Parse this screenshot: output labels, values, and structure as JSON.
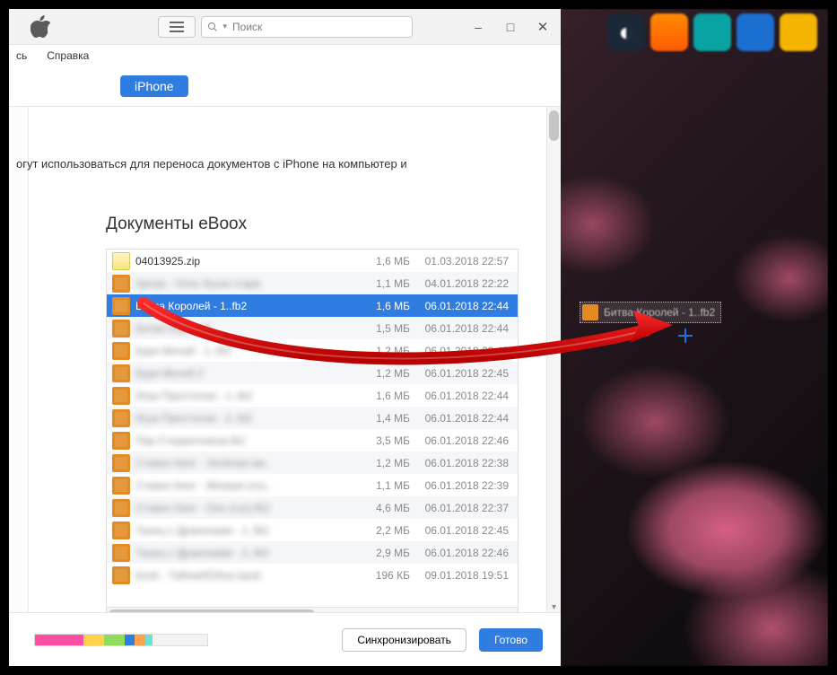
{
  "window": {
    "minimize": "–",
    "maximize": "□",
    "close": "✕"
  },
  "toolbar": {
    "search_icon": "search-icon",
    "search_placeholder": "Поиск",
    "search_chevron": "▾"
  },
  "menubar": {
    "item1": "сь",
    "item2": "Справка"
  },
  "iphone_label": "iPhone",
  "description": "огут использоваться для переноса документов с iPhone на компьютер и",
  "panel_title": "Документы eBoox",
  "files": [
    {
      "icon": "zip",
      "name": "04013925.zip",
      "blur": false,
      "size": "1,6 МБ",
      "date": "01.03.2018 22:57"
    },
    {
      "icon": "fb2",
      "name": "Арчер - Ночь была стара",
      "blur": true,
      "size": "1,1 МБ",
      "date": "04.01.2018 22:22"
    },
    {
      "icon": "fb2",
      "name": "Битва Королей - 1..fb2",
      "blur": false,
      "size": "1,6 МБ",
      "date": "06.01.2018 22:44",
      "selected": true
    },
    {
      "icon": "fb2",
      "name": "Битва Королей",
      "blur": true,
      "size": "1,5 МБ",
      "date": "06.01.2018 22:44"
    },
    {
      "icon": "fb2",
      "name": "Буря Мечей - 1..fb2",
      "blur": true,
      "size": "1,2 МБ",
      "date": "06.01.2018 22:45"
    },
    {
      "icon": "fb2",
      "name": "Буря Мечей 2",
      "blur": true,
      "size": "1,2 МБ",
      "date": "06.01.2018 22:45"
    },
    {
      "icon": "fb2",
      "name": "Игра Престолов - 1..fb2",
      "blur": true,
      "size": "1,6 МБ",
      "date": "06.01.2018 22:44"
    },
    {
      "icon": "fb2",
      "name": "Игра Престолов - 2..fb2",
      "blur": true,
      "size": "1,4 МБ",
      "date": "06.01.2018 22:44"
    },
    {
      "icon": "fb2",
      "name": "Пир Стервятников.fb2",
      "blur": true,
      "size": "3,5 МБ",
      "date": "06.01.2018 22:46"
    },
    {
      "icon": "fb2",
      "name": "Стивен Кинг - Зелёная ми..",
      "blur": true,
      "size": "1,2 МБ",
      "date": "06.01.2018 22:38"
    },
    {
      "icon": "fb2",
      "name": "Стивен Кинг - Мизери (rus..",
      "blur": true,
      "size": "1,1 МБ",
      "date": "06.01.2018 22:39"
    },
    {
      "icon": "fb2",
      "name": "Стивен Кинг - Оно (rus).fb2",
      "blur": true,
      "size": "4,6 МБ",
      "date": "06.01.2018 22:37"
    },
    {
      "icon": "fb2",
      "name": "Танец с Драконами - 1..fb2",
      "blur": true,
      "size": "2,2 МБ",
      "date": "06.01.2018 22:45"
    },
    {
      "icon": "fb2",
      "name": "Танец с Драконами - 2..fb2",
      "blur": true,
      "size": "2,9 МБ",
      "date": "06.01.2018 22:46"
    },
    {
      "icon": "fb2",
      "name": "book - Тайная916на.epub",
      "blur": true,
      "size": "196 КБ",
      "date": "09.01.2018 19:51"
    }
  ],
  "footer": {
    "sync_label": "Синхронизировать",
    "done_label": "Готово"
  },
  "drag_ghost_label": "Битва Королей - 1..fb2"
}
